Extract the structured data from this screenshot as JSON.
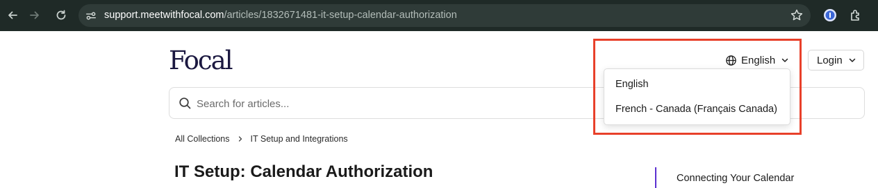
{
  "browser": {
    "url_host": "support.meetwithfocal.com",
    "url_path": "/articles/1832671481-it-setup-calendar-authorization",
    "icons": [
      "back-icon",
      "forward-icon",
      "reload-icon",
      "site-info-icon",
      "star-icon",
      "password-manager-icon",
      "extensions-icon"
    ]
  },
  "header": {
    "logo_text": "Focal",
    "language_label": "English",
    "login_label": "Login"
  },
  "search": {
    "placeholder": "Search for articles..."
  },
  "language_dropdown": {
    "options": [
      "English",
      "French - Canada (Français Canada)"
    ]
  },
  "breadcrumb": {
    "items": [
      "All Collections",
      "IT Setup and Integrations"
    ]
  },
  "article": {
    "title": "IT Setup: Calendar Authorization"
  },
  "toc": {
    "items": [
      "Connecting Your Calendar"
    ]
  },
  "colors": {
    "chrome_bg": "#1f2a27",
    "omnibox_bg": "#2f3b38",
    "highlight": "#e8402a",
    "toc_accent": "#5b2fd1",
    "logo": "#1b1840"
  }
}
